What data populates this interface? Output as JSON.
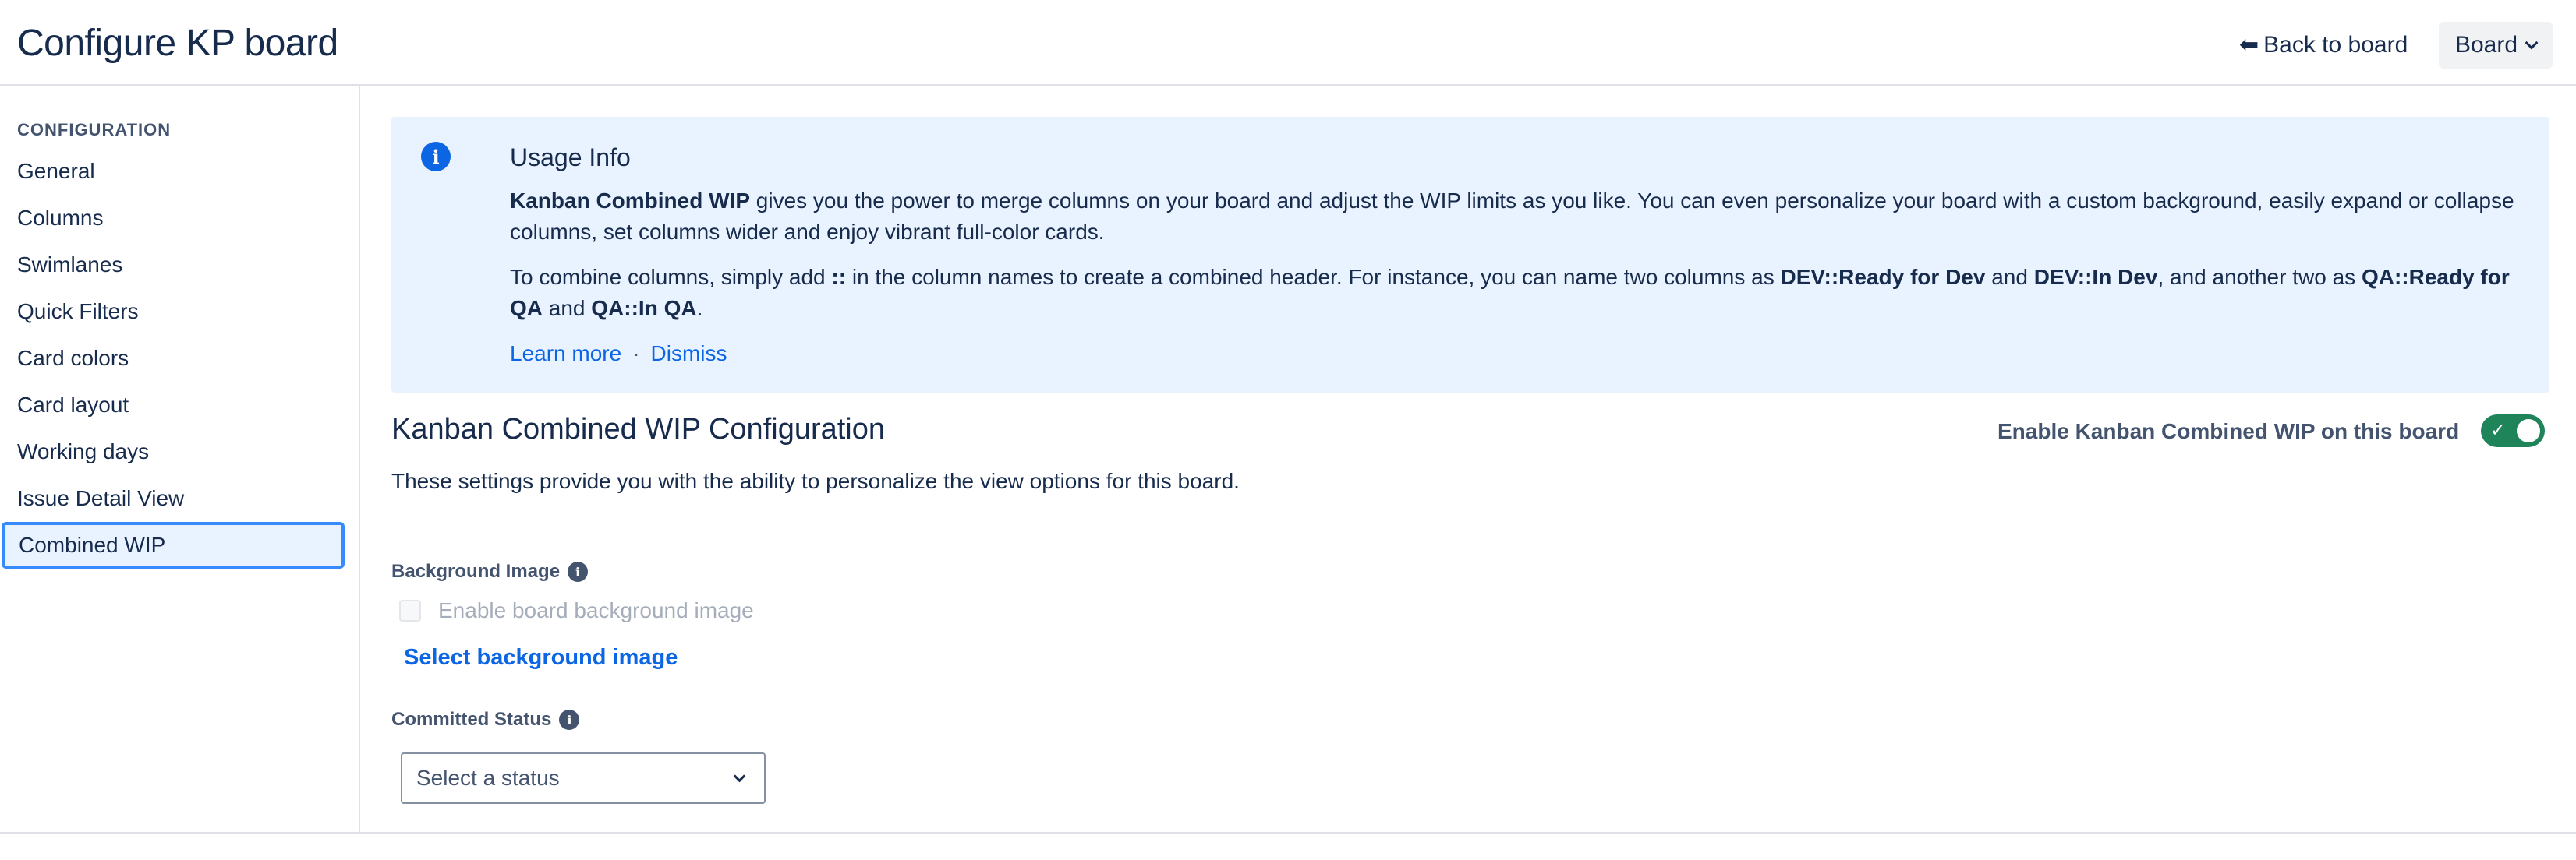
{
  "header": {
    "title": "Configure KP board",
    "back_link": "Back to board",
    "back_arrow": "⬅",
    "board_button": "Board"
  },
  "sidebar": {
    "heading": "CONFIGURATION",
    "items": [
      {
        "label": "General"
      },
      {
        "label": "Columns"
      },
      {
        "label": "Swimlanes"
      },
      {
        "label": "Quick Filters"
      },
      {
        "label": "Card colors"
      },
      {
        "label": "Card layout"
      },
      {
        "label": "Working days"
      },
      {
        "label": "Issue Detail View"
      },
      {
        "label": "Combined WIP",
        "active": true
      }
    ]
  },
  "info": {
    "icon": "info-icon",
    "title": "Usage Info",
    "p1_bold": "Kanban Combined WIP",
    "p1_rest": " gives you the power to merge columns on your board and adjust the WIP limits as you like. You can even personalize your board with a custom background, easily expand or collapse columns, set columns wider and enjoy vibrant full-color cards.",
    "p2_a": "To combine columns, simply add ",
    "p2_sep": "::",
    "p2_b": " in the column names to create a combined header. For instance, you can name two columns as ",
    "p2_c1": "DEV::Ready for Dev",
    "p2_and1": " and ",
    "p2_c2": "DEV::In Dev",
    "p2_d": ", and another two as ",
    "p2_c3": "QA::Ready for QA",
    "p2_and2": " and ",
    "p2_c4": "QA::In QA",
    "p2_end": ".",
    "learn_more": "Learn more",
    "dot": "·",
    "dismiss": "Dismiss"
  },
  "config": {
    "title": "Kanban Combined WIP Configuration",
    "toggle_label": "Enable Kanban Combined WIP on this board",
    "toggle_on": true,
    "toggle_check": "✓",
    "description": "These settings provide you with the ability to personalize the view options for this board.",
    "background_label": "Background Image",
    "info_glyph": "i",
    "checkbox_label": "Enable board background image",
    "checkbox_checked": false,
    "select_bg_link": "Select background image",
    "committed_label": "Committed Status",
    "status_placeholder": "Select a status"
  },
  "colors": {
    "accent": "#0c66e4",
    "toggle_on": "#1f845a",
    "info_bg": "#e9f2ff",
    "active_border": "#388bff"
  }
}
